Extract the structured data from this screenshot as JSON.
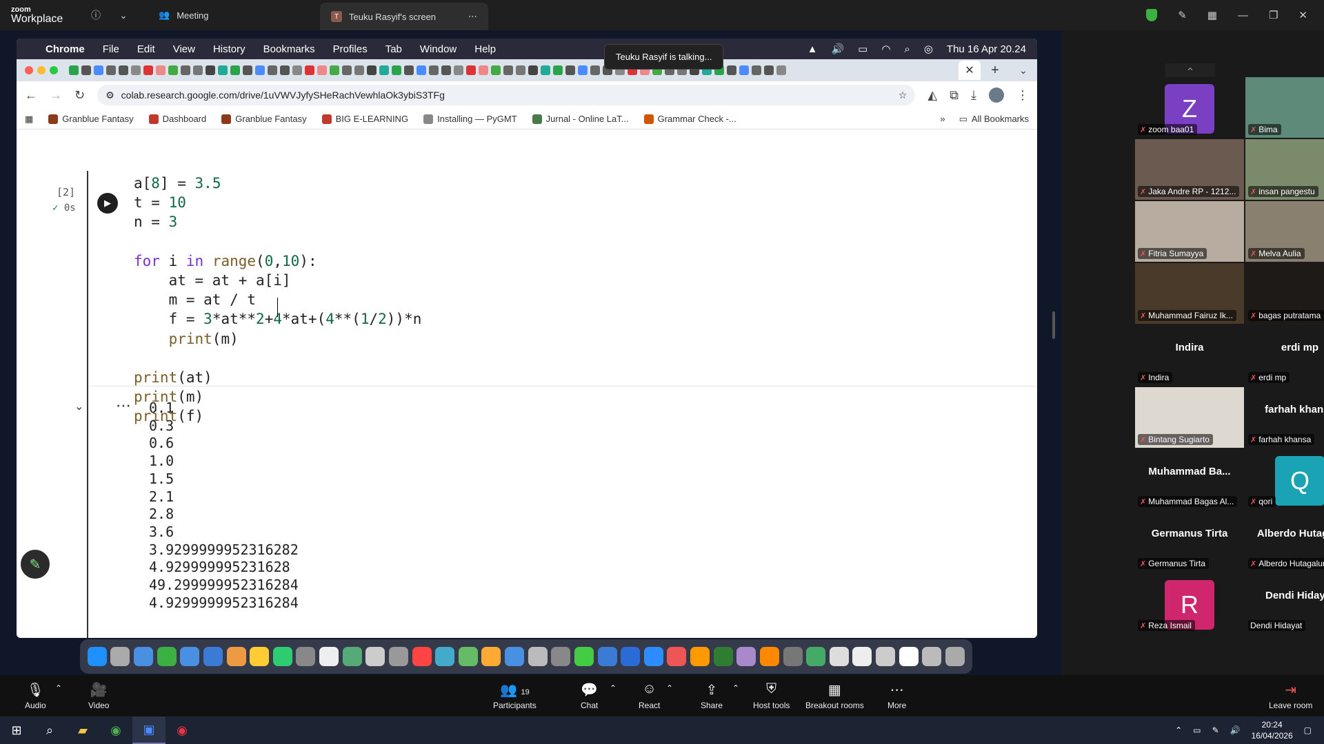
{
  "zoom": {
    "logo_line1": "zoom",
    "logo_line2": "Workplace",
    "meeting_tab": "Meeting",
    "share_tab": "Teuku Rasyif's screen",
    "share_tab_avatar": "T"
  },
  "mac": {
    "menu": [
      "Chrome",
      "File",
      "Edit",
      "View",
      "History",
      "Bookmarks",
      "Profiles",
      "Tab",
      "Window",
      "Help"
    ],
    "clock": "Thu 16 Apr  20.24",
    "talking": "Teuku Rasyif is talking..."
  },
  "browser": {
    "url": "colab.research.google.com/drive/1uVWVJyfySHeRachVewhlaOk3ybiS3TFg",
    "bookmarks": [
      {
        "label": "Granblue Fantasy",
        "color": "#8b3a1a"
      },
      {
        "label": "Dashboard",
        "color": "#c0392b"
      },
      {
        "label": "Granblue Fantasy",
        "color": "#8b3a1a"
      },
      {
        "label": "BIG E-LEARNING",
        "color": "#c0392b"
      },
      {
        "label": "Installing — PyGMT",
        "color": "#888888"
      },
      {
        "label": "Jurnal - Online LaT...",
        "color": "#4a7a4a"
      },
      {
        "label": "Grammar Check -...",
        "color": "#d35400"
      }
    ],
    "all_bookmarks": "All Bookmarks"
  },
  "colab": {
    "cell_count": "[2]",
    "cell_time": "0s",
    "code_lines": [
      "a[8] = 3.5",
      "t = 10",
      "n = 3",
      "",
      "for i in range(0,10):",
      "    at = at + a[i]",
      "    m = at / t",
      "    f = 3*at**2+4*at+(4**(1/2))*n",
      "    print(m)",
      "",
      "print(at)",
      "print(m)",
      "print(f)"
    ],
    "output_lines": [
      "0.1",
      "0.3",
      "0.6",
      "1.0",
      "1.5",
      "2.1",
      "2.8",
      "3.6",
      "3.9299999952316282",
      "4.929999995231628",
      "49.299999952316284",
      "4.9299999952316284"
    ]
  },
  "participants": [
    {
      "name": "zoom baa01",
      "type": "avatar",
      "letter": "Z",
      "color": "#7b3fc4"
    },
    {
      "name": "Bima",
      "type": "video",
      "color": "#5e8a7a"
    },
    {
      "name": "Jaka Andre RP - 1212...",
      "type": "video",
      "color": "#6a5a50"
    },
    {
      "name": "insan pangestu",
      "type": "video",
      "color": "#7a8a6a"
    },
    {
      "name": "Fitria Sumayya",
      "type": "video",
      "color": "#b8aca0"
    },
    {
      "name": "Melva Aulia",
      "type": "video",
      "color": "#8a8070"
    },
    {
      "name": "Muhammad Fairuz Ik...",
      "type": "video",
      "color": "#4a3a2a"
    },
    {
      "name": "bagas putratama",
      "type": "video",
      "color": "#1e1a18"
    },
    {
      "name": "Indira",
      "type": "name",
      "big": "Indira"
    },
    {
      "name": "erdi mp",
      "type": "name",
      "big": "erdi mp"
    },
    {
      "name": "Bintang Sugiarto",
      "type": "photo",
      "color": "#ddd8d0"
    },
    {
      "name": "farhah khansa",
      "type": "name",
      "big": "farhah khansa"
    },
    {
      "name": "Muhammad Bagas Al...",
      "type": "name",
      "big": "Muhammad Ba..."
    },
    {
      "name": "qori",
      "type": "avatar",
      "letter": "Q",
      "color": "#1aa3b5"
    },
    {
      "name": "Germanus Tirta",
      "type": "name",
      "big": "Germanus Tirta"
    },
    {
      "name": "Alberdo Hutagalung",
      "type": "name",
      "big": "Alberdo Hutaga..."
    },
    {
      "name": "Reza Ismail",
      "type": "avatar",
      "letter": "R",
      "color": "#d0266e"
    },
    {
      "name": "Dendi Hidayat",
      "type": "name",
      "big": "Dendi Hidayat",
      "nomic": true
    }
  ],
  "controls": {
    "audio": "Audio",
    "video": "Video",
    "participants": "Participants",
    "participants_count": "19",
    "chat": "Chat",
    "react": "React",
    "share": "Share",
    "host_tools": "Host tools",
    "breakout": "Breakout rooms",
    "more": "More",
    "leave": "Leave room"
  },
  "taskbar": {
    "time": "20:24",
    "date": "16/04/2026"
  }
}
